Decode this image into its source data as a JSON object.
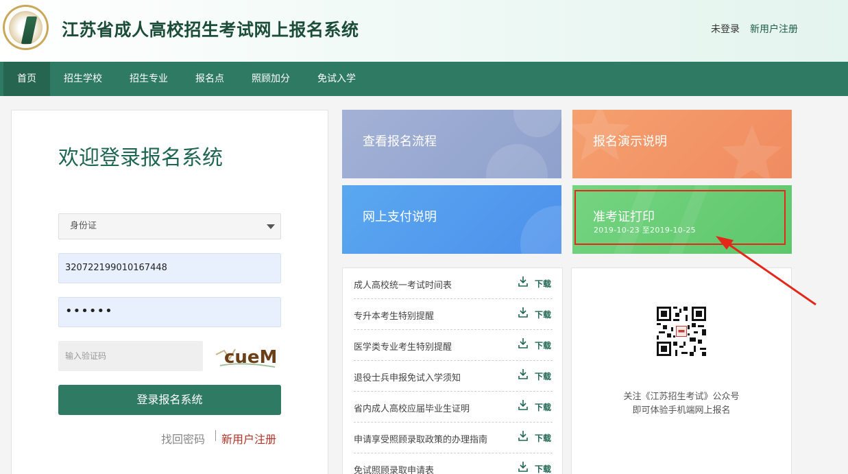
{
  "header": {
    "site_title": "江苏省成人高校招生考试网上报名系统",
    "not_logged_in": "未登录",
    "register": "新用户注册"
  },
  "nav": {
    "items": [
      {
        "label": "首页",
        "active": true
      },
      {
        "label": "招生学校"
      },
      {
        "label": "招生专业"
      },
      {
        "label": "报名点"
      },
      {
        "label": "照顾加分"
      },
      {
        "label": "免试入学"
      }
    ]
  },
  "login": {
    "title": "欢迎登录报名系统",
    "id_type": "身份证",
    "id_number": "320722199010167448",
    "password_mask": "••••••",
    "captcha_placeholder": "输入验证码",
    "captcha_text": "cueM",
    "submit": "登录报名系统",
    "forgot": "找回密码",
    "register": "新用户注册"
  },
  "tiles": {
    "flow": "查看报名流程",
    "demo": "报名演示说明",
    "pay": "网上支付说明",
    "print": "准考证打印",
    "print_dates": "2019-10-23 至2019-10-25"
  },
  "downloads": {
    "download_label": "下载",
    "items": [
      "成人高校统一考试时间表",
      "专升本考生特别提醒",
      "医学类专业考生特别提醒",
      "退役士兵申报免试入学须知",
      "省内成人高校应届毕业生证明",
      "申请享受照顾录取政策的办理指南",
      "免试照顾录取申请表"
    ]
  },
  "qr": {
    "line1": "关注《江苏招生考试》公众号",
    "line2": "即可体验手机端网上报名"
  },
  "colors": {
    "primary": "#2f7a62",
    "highlight": "#e3281a"
  }
}
